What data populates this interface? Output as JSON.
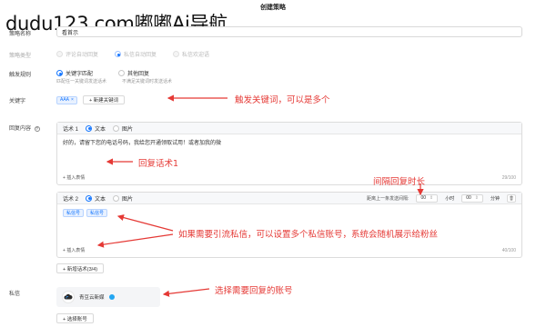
{
  "page_title": "创建策略",
  "watermark": "dudu123.com嘟嘟Ai导航",
  "form": {
    "strategy_name": {
      "label": "策略名称",
      "value": "看首示"
    },
    "strategy_type": {
      "label": "策略类型",
      "options": [
        {
          "label": "评论自动回复",
          "selected": false,
          "disabled": true
        },
        {
          "label": "私信自动回复",
          "selected": true,
          "disabled": true
        },
        {
          "label": "私信欢迎语",
          "selected": false,
          "disabled": true
        }
      ]
    },
    "trigger_rule": {
      "label": "触发规则",
      "options": [
        {
          "label": "关键字匹配",
          "hint": "匹配任一关键词发送话术",
          "selected": true
        },
        {
          "label": "其他回复",
          "hint": "不满足关键词时发送话术",
          "selected": false
        }
      ]
    },
    "keywords": {
      "label": "关键字",
      "tags": [
        "AAA"
      ],
      "add_button": "+ 新建关键词"
    },
    "reply_content": {
      "label": "回复内容",
      "help_icon": "question-circle-icon",
      "script1": {
        "title": "话术 1",
        "type_text": "文本",
        "type_image": "图片",
        "selected_type": "text",
        "content": "好的，请留下您的电话号码，我给您开通领取试用！或者加我的微",
        "insert_label": "+ 插入表情",
        "counter": "29/100"
      },
      "script2": {
        "title": "话术 2",
        "type_text": "文本",
        "type_image": "图片",
        "selected_type": "text",
        "interval_label": "距离上一条发送间隔:",
        "interval_minutes": "00",
        "minutes_unit": "小时",
        "interval_seconds": "00",
        "seconds_unit": "分钟",
        "delete_icon": "trash-icon",
        "tags": [
          "私信号",
          "私信号"
        ],
        "insert_label": "+ 插入表情",
        "counter": "40/100"
      },
      "add_script_button": "+ 新增话术(3/4)"
    },
    "private_message": {
      "label": "私信",
      "account_name": "青豆云新媒",
      "verified_icon": "verified-badge-icon",
      "add_account_button": "+ 选择账号"
    }
  },
  "annotations": {
    "keywords": "触发关键词，可以是多个",
    "reply1": "回复话术1",
    "interval": "间隔回复时长",
    "multi_account": "如果需要引流私信，可以设置多个私信账号，系统会随机展示给粉丝",
    "choose_account": "选择需要回复的账号"
  },
  "colors": {
    "accent": "#1677ff",
    "annotation": "#e53935"
  }
}
